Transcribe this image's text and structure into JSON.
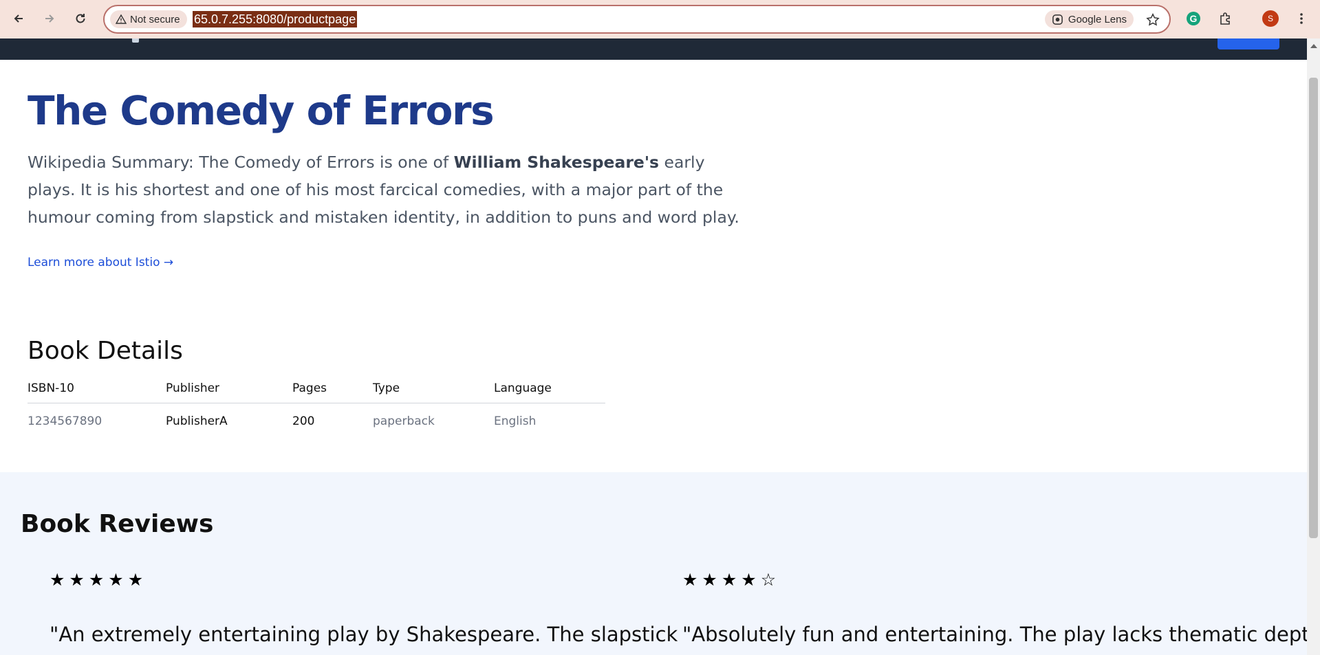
{
  "browser": {
    "security_label": "Not secure",
    "url": "65.0.7.255:8080/productpage",
    "lens_label": "Google Lens",
    "profile_initial": "S"
  },
  "book": {
    "title": "The Comedy of Errors",
    "summary_prefix": "Wikipedia Summary: The Comedy of Errors is one of ",
    "summary_bold": "William Shakespeare's",
    "summary_suffix": " early plays. It is his shortest and one of his most farcical comedies, with a major part of the humour coming from slapstick and mistaken identity, in addition to puns and word play.",
    "learn_more": "Learn more about Istio →"
  },
  "details": {
    "title": "Book Details",
    "headers": [
      "ISBN-10",
      "Publisher",
      "Pages",
      "Type",
      "Language"
    ],
    "values": [
      "1234567890",
      "PublisherA",
      "200",
      "paperback",
      "English"
    ]
  },
  "reviews": {
    "title": "Book Reviews",
    "items": [
      {
        "rating": 5,
        "max": 5,
        "text": "\"An extremely entertaining play by Shakespeare. The slapstick"
      },
      {
        "rating": 4,
        "max": 5,
        "text": "\"Absolutely fun and entertaining. The play lacks thematic depth"
      }
    ]
  }
}
